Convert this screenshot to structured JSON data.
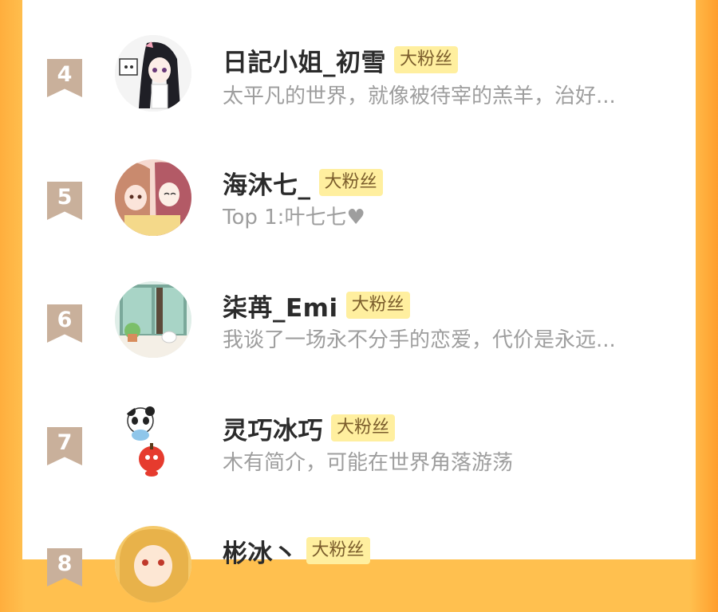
{
  "accent": {
    "page_bg": "#ffc04f",
    "badge_bg": "#ffef9f",
    "badge_text": "#7b5d2c",
    "rank_ribbon": "#c9b09b"
  },
  "fan_list": [
    {
      "rank": "4",
      "name": "日記小姐_初雪",
      "badge": "大粉丝",
      "signature": "太平凡的世界，就像被待宰的羔羊，治好...",
      "avatar": "anime-girl-avatar"
    },
    {
      "rank": "5",
      "name": "海沐七_",
      "badge": "大粉丝",
      "signature": "Top 1:叶七七♥",
      "avatar": "two-girls-avatar"
    },
    {
      "rank": "6",
      "name": "柒苒_Emi",
      "badge": "大粉丝",
      "signature": "我谈了一场永不分手的恋爱，代价是永远...",
      "avatar": "window-cat-avatar"
    },
    {
      "rank": "7",
      "name": "灵巧冰巧",
      "badge": "大粉丝",
      "signature": "木有简介，可能在世界角落游荡",
      "avatar": "panda-apple-avatar"
    },
    {
      "rank": "8",
      "name": "彬冰丶",
      "badge": "大粉丝",
      "signature": "",
      "avatar": "blonde-girl-avatar"
    }
  ]
}
